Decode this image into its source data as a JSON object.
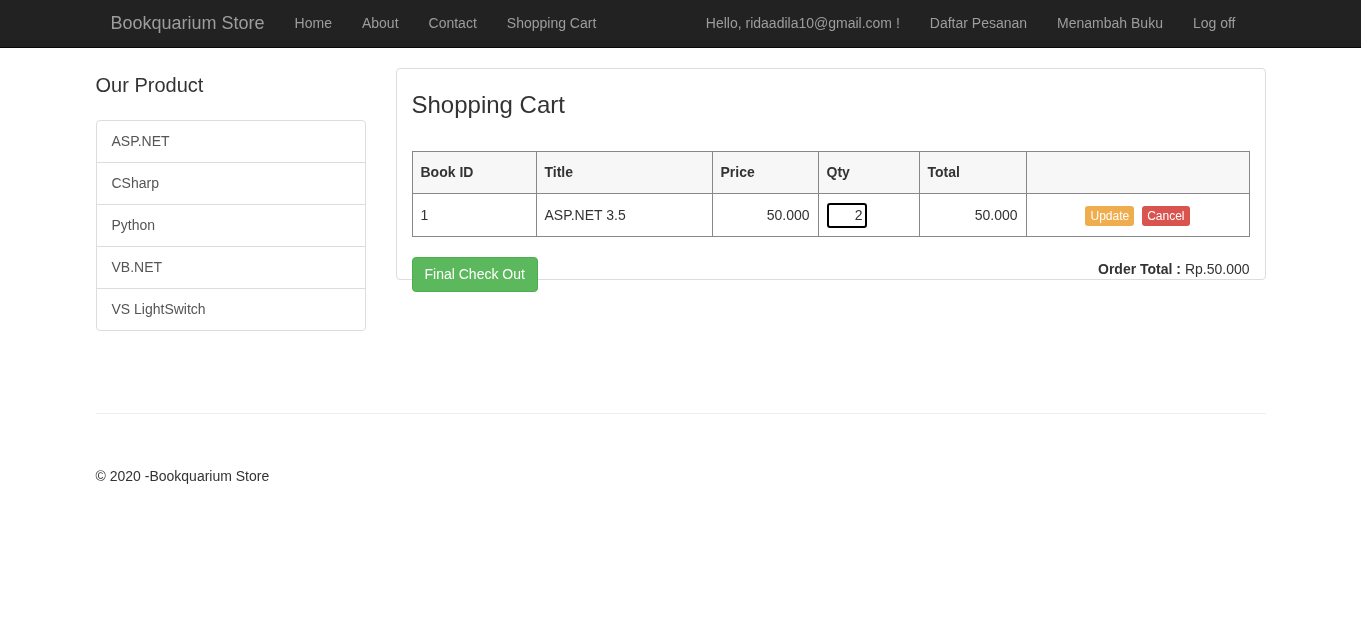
{
  "navbar": {
    "brand": "Bookquarium Store",
    "links": [
      "Home",
      "About",
      "Contact",
      "Shopping Cart"
    ],
    "right_links": [
      "Hello, ridaadila10@gmail.com !",
      "Daftar Pesanan",
      "Menambah Buku",
      "Log off"
    ]
  },
  "sidebar": {
    "title": "Our Product",
    "items": [
      "ASP.NET",
      "CSharp",
      "Python",
      "VB.NET",
      "VS LightSwitch"
    ]
  },
  "cart": {
    "title": "Shopping Cart",
    "columns": [
      "Book ID",
      "Title",
      "Price",
      "Qty",
      "Total"
    ],
    "rows": [
      {
        "book_id": "1",
        "title": "ASP.NET 3.5",
        "price": "50.000",
        "qty": "2",
        "total": "50.000",
        "update": "Update",
        "cancel": "Cancel"
      }
    ],
    "checkout": "Final Check Out",
    "order_total": "**Order Total :** Rp.50.000"
  },
  "footer": "© 2020 -Bookquarium Store"
}
